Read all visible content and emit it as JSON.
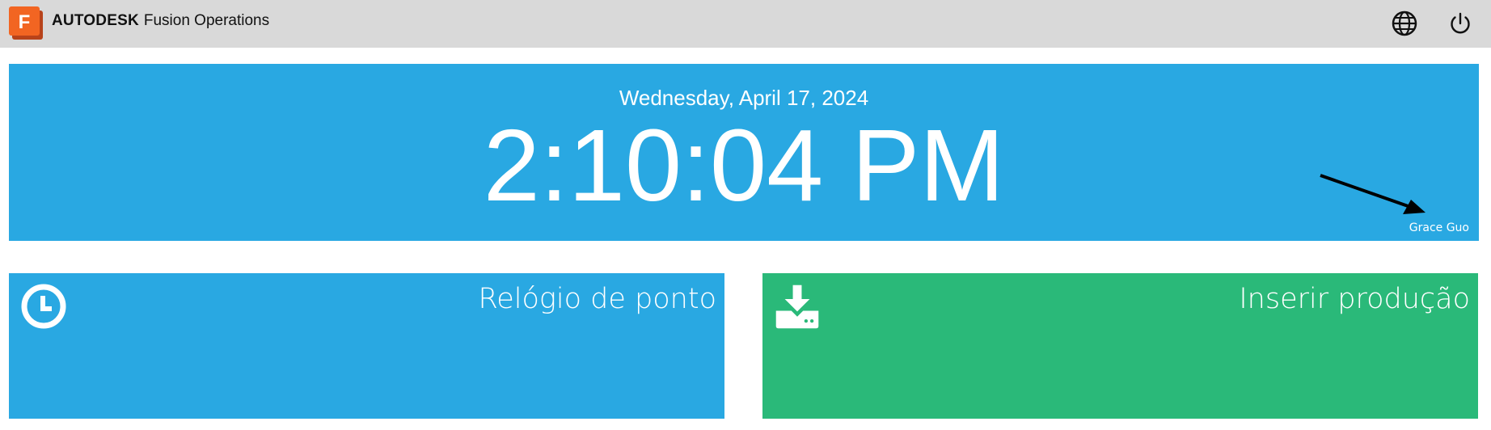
{
  "header": {
    "brand_primary": "AUTODESK",
    "brand_secondary": "Fusion Operations",
    "logo_letter": "F",
    "logo_icon": "fusion-logo-icon",
    "language_icon": "globe-icon",
    "power_icon": "power-icon"
  },
  "clock": {
    "date": "Wednesday, April 17, 2024",
    "time": "2:10:04 PM",
    "user": "Grace Guo"
  },
  "tiles": [
    {
      "label": "Relógio de ponto",
      "icon": "clock-icon",
      "color": "#29a8e2"
    },
    {
      "label": "Inserir produção",
      "icon": "download-icon",
      "color": "#2ab979"
    }
  ],
  "colors": {
    "topbar": "#d9d9d9",
    "clock_panel": "#29a8e2",
    "logo_orange": "#f26522"
  }
}
